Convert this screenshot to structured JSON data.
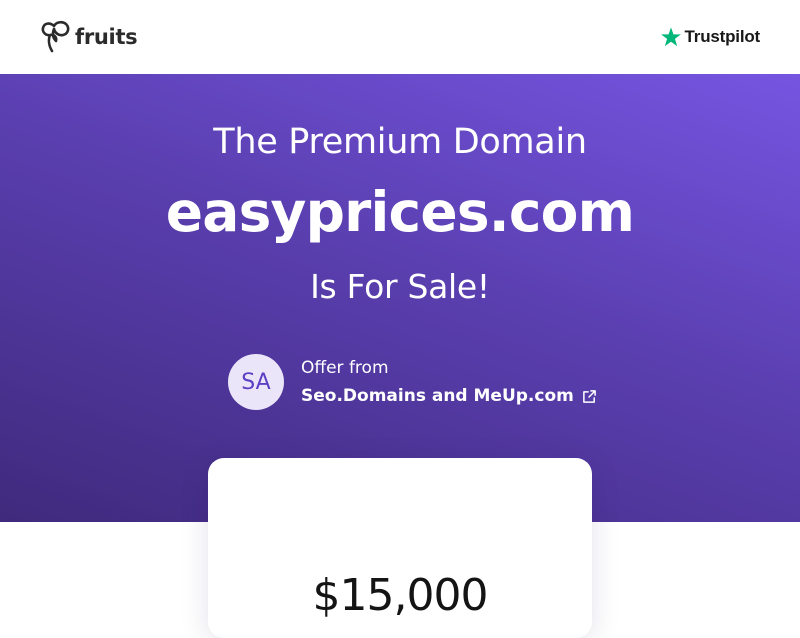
{
  "header": {
    "logo_text": "fruits",
    "trustpilot_text": "Trustpilot"
  },
  "hero": {
    "line1": "The Premium Domain",
    "domain": "easyprices.com",
    "line3": "Is For Sale!"
  },
  "seller": {
    "avatar_initials": "SA",
    "label": "Offer from",
    "name": "Seo.Domains and MeUp.com"
  },
  "price_card": {
    "price": "$15,000"
  },
  "icons": {
    "logo": "fruits-logo-icon",
    "trustpilot": "star-icon",
    "external_link": "external-link-icon"
  },
  "colors": {
    "hero_gradient_start": "#7655e1",
    "hero_gradient_end": "#3f2a7d",
    "trustpilot_green": "#00b67a",
    "avatar_bg": "#ebe5fa",
    "avatar_text": "#5c3fc4"
  }
}
